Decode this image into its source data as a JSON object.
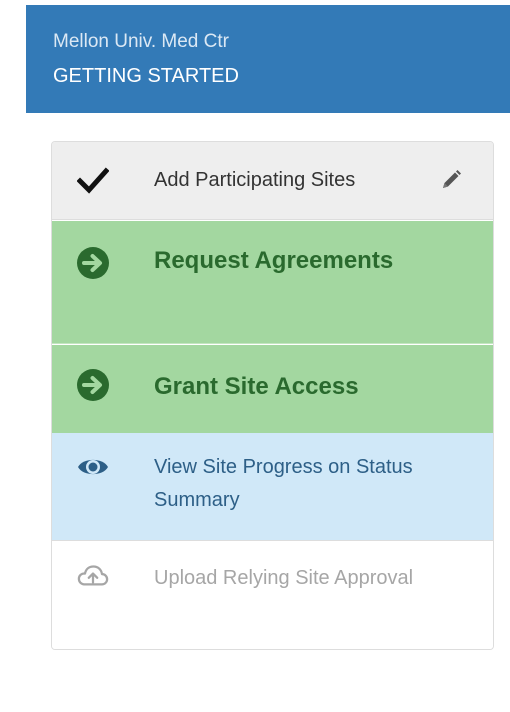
{
  "header": {
    "org": "Mellon Univ. Med Ctr",
    "title": "GETTING STARTED"
  },
  "colors": {
    "header_bg": "#337ab7",
    "complete_bg": "#eeeeee",
    "active_bg": "#a3d7a0",
    "active_text": "#2a6a2e",
    "info_bg": "#d0e8f8",
    "info_text": "#2d5f87",
    "disabled_text": "#a6a6a6"
  },
  "steps": [
    {
      "label": "Add Participating Sites",
      "icon": "checkmark-icon",
      "state": "complete",
      "action_icon": "pencil-icon"
    },
    {
      "label": "Request Agreements",
      "icon": "arrow-circle-right-icon",
      "state": "active"
    },
    {
      "label": "Grant Site Access",
      "icon": "arrow-circle-right-icon",
      "state": "active"
    },
    {
      "label": "View Site Progress on Status Summary",
      "icon": "eye-icon",
      "state": "info"
    },
    {
      "label": "Upload Relying Site Approval",
      "icon": "cloud-upload-icon",
      "state": "disabled"
    }
  ]
}
